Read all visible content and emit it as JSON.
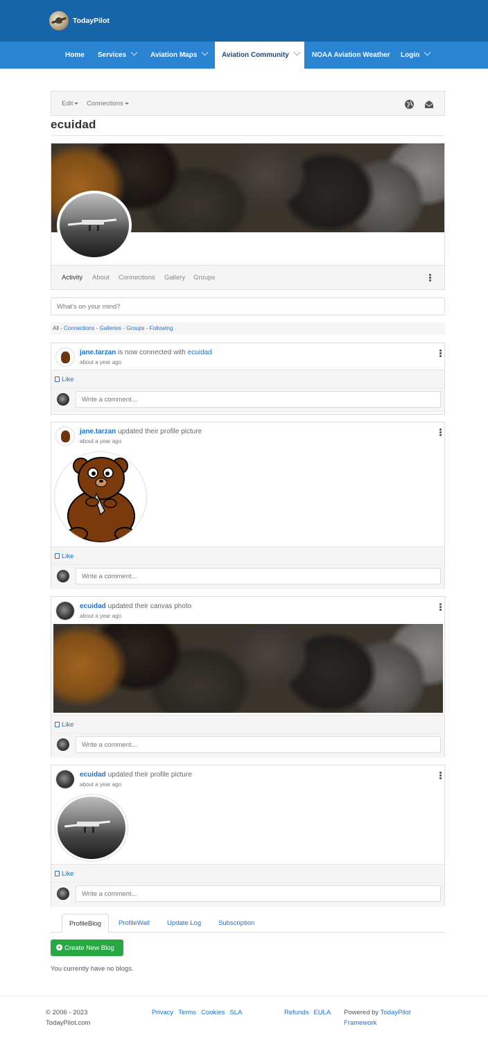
{
  "header": {
    "logo_text": "TodayPilot"
  },
  "nav": {
    "items": [
      {
        "label": "Home",
        "has_dropdown": false
      },
      {
        "label": "Services",
        "has_dropdown": true
      },
      {
        "label": "Aviation Maps",
        "has_dropdown": true
      },
      {
        "label": "Aviation Community",
        "has_dropdown": true,
        "active": true
      },
      {
        "label": "NOAA Aviation Weather",
        "has_dropdown": false
      },
      {
        "label": "Login",
        "has_dropdown": true
      }
    ]
  },
  "toolbar": {
    "edit_label": "Edit",
    "connections_label": "Connections",
    "icons": [
      "globe-icon",
      "envelope-open-icon"
    ]
  },
  "profile": {
    "username": "ecuidad",
    "tabs": [
      "Activity",
      "About",
      "Connections",
      "Gallery",
      "Groups"
    ],
    "active_tab": "Activity"
  },
  "status": {
    "placeholder": "What's on your mind?"
  },
  "filters": {
    "all_label": "All",
    "links": [
      "Connections",
      "Galleries",
      "Groups",
      "Following"
    ]
  },
  "feed": {
    "like_label": "Like",
    "comment_placeholder": "Write a comment...",
    "items": [
      {
        "actor": "jane.tarzan",
        "text": " is now connected with ",
        "target": "ecuidad",
        "time": "about a year ago"
      },
      {
        "actor": "jane.tarzan",
        "text": " updated their profile picture",
        "time": "about a year ago"
      },
      {
        "actor": "ecuidad",
        "text": " updated their canvas photo",
        "time": "about a year ago"
      },
      {
        "actor": "ecuidad",
        "text": " updated their profile picture",
        "time": "about a year ago"
      }
    ]
  },
  "blog": {
    "tabs": [
      "ProfileBlog",
      "ProfileWall",
      "Update Log",
      "Subscription"
    ],
    "active_tab": "ProfileBlog",
    "create_button": "Create New Blog",
    "empty_text": "You currently have no blogs."
  },
  "footer": {
    "copyright_line1": "© 2006 - 2023",
    "copyright_line2": "TodayPilot.com",
    "links_group1": [
      "Privacy",
      "Terms",
      "Cookies",
      "SLA"
    ],
    "links_group2": [
      "Refunds",
      "EULA"
    ],
    "powered_prefix": "Powered by ",
    "powered_link": "TodayPilot",
    "powered_line2": "Framework"
  },
  "colors": {
    "header_bg": "#1565a8",
    "nav_bg": "#2b84d1",
    "link": "#1a73d9",
    "button_green": "#28a745"
  }
}
